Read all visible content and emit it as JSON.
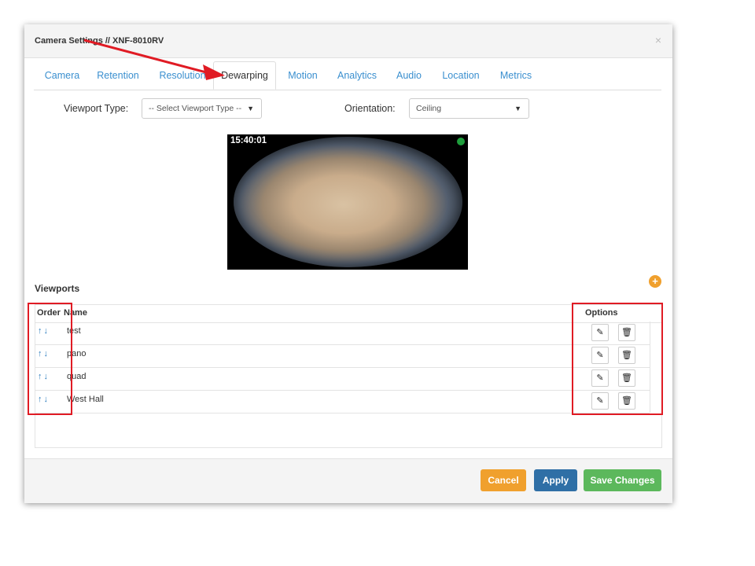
{
  "modal": {
    "title": "Camera Settings // XNF-8010RV",
    "close_label": "×"
  },
  "tabs": [
    {
      "label": "Camera",
      "active": false
    },
    {
      "label": "Retention",
      "active": false
    },
    {
      "label": "Resolution",
      "active": false
    },
    {
      "label": "Dewarping",
      "active": true
    },
    {
      "label": "Motion",
      "active": false
    },
    {
      "label": "Analytics",
      "active": false
    },
    {
      "label": "Audio",
      "active": false
    },
    {
      "label": "Location",
      "active": false
    },
    {
      "label": "Metrics",
      "active": false
    }
  ],
  "dewarping": {
    "viewport_type_label": "Viewport Type:",
    "viewport_type_value": "-- Select Viewport Type --",
    "orientation_label": "Orientation:",
    "orientation_value": "Ceiling"
  },
  "preview": {
    "timestamp": "15:40:01",
    "status_color": "#1e9e3c"
  },
  "viewports": {
    "title": "Viewports",
    "add_icon": "plus-circle-icon",
    "columns": {
      "order": "Order",
      "name": "Name",
      "options": "Options"
    },
    "order_icons": "↑↓",
    "edit_icon": "pencil-icon",
    "delete_icon": "trash-icon",
    "rows": [
      {
        "name": "test"
      },
      {
        "name": "pano"
      },
      {
        "name": "quad"
      },
      {
        "name": "West Hall"
      }
    ]
  },
  "footer": {
    "cancel_label": "Cancel",
    "apply_label": "Apply",
    "save_label": "Save Changes"
  },
  "colors": {
    "cancel": "#f0a02d",
    "apply": "#2f6fa6",
    "save": "#5cb85c",
    "annotation": "#e01b24"
  }
}
